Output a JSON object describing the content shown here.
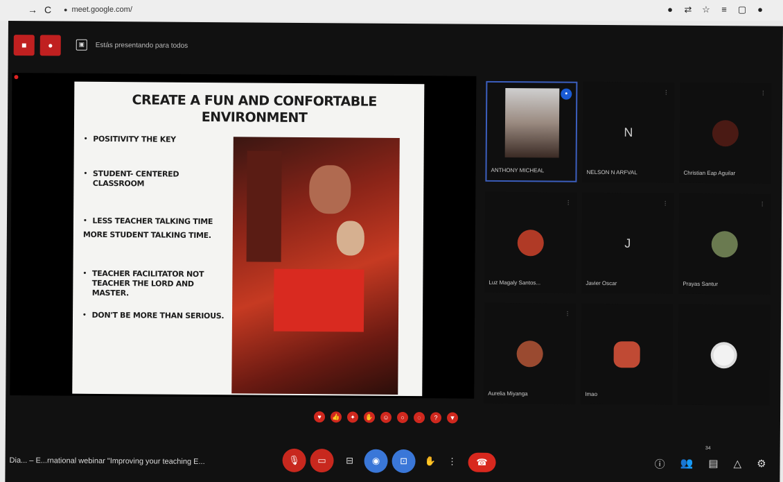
{
  "browser": {
    "back": "←",
    "forward": "→",
    "reload": "C",
    "url": "meet.google.com/"
  },
  "top_bar": {
    "present_label": "Estás presentando para todos"
  },
  "slide": {
    "title_line1": "CREATE A FUN AND CONFORTABLE",
    "title_line2": "ENVIRONMENT",
    "bullets": [
      "POSITIVITY THE KEY",
      "STUDENT- CENTERED CLASSROOM",
      "LESS TEACHER TALKING TIME",
      "TEACHER FACILITATOR NOT TEACHER THE LORD AND MASTER.",
      "DON'T BE MORE THAN SERIOUS."
    ],
    "plain_line": "MORE STUDENT TALKING TIME."
  },
  "participants": [
    {
      "name": "ANTHONY MICHEAL",
      "type": "video"
    },
    {
      "name": "NELSON N ARFVAL",
      "type": "letter",
      "letter": "N"
    },
    {
      "name": "Christian Eap Aguilar",
      "type": "blank"
    },
    {
      "name": "Luz Magaly Santos...",
      "type": "avatar"
    },
    {
      "name": "Javier Oscar",
      "type": "letter",
      "letter": "J"
    },
    {
      "name": "Prayas Santur",
      "type": "avatar"
    },
    {
      "name": "Aurelia Miyanga",
      "type": "avatar"
    },
    {
      "name": "Imao",
      "type": "avatar"
    },
    {
      "name": "",
      "type": "avatar"
    }
  ],
  "meeting": {
    "title": "Dia... – E...rnational webinar \"Improving your teaching E...",
    "participant_count": "34"
  },
  "colors": {
    "red": "#c8281e",
    "blue": "#3a77d8",
    "active_border": "#3c5fbf"
  }
}
